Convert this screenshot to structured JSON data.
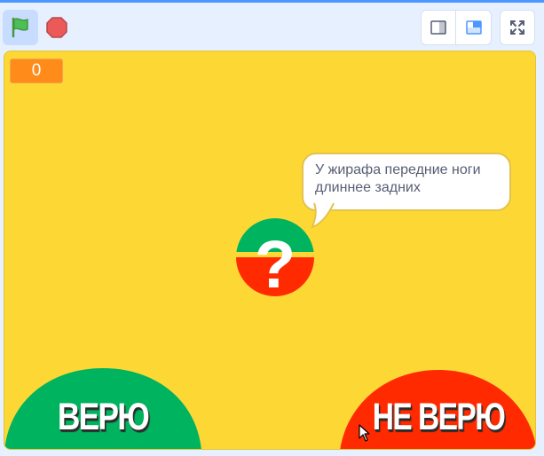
{
  "toolbar": {
    "green_flag_icon": "green-flag-icon",
    "stop_icon": "stop-sign-icon",
    "small_stage_icon": "small-stage-icon",
    "normal_stage_icon": "normal-stage-icon",
    "fullscreen_icon": "fullscreen-icon"
  },
  "stage": {
    "score_value": "0",
    "speech_text": "У жирафа передние ноги длиннее задних",
    "question_mark": "?",
    "believe_label": "ВЕРЮ",
    "not_believe_label": "НЕ ВЕРЮ"
  },
  "colors": {
    "stage_background": "#fdd835",
    "score_monitor": "#ff8c1a",
    "believe_green": "#00b35f",
    "not_believe_red": "#ff2a00",
    "accent_blue": "#4c97ff"
  }
}
